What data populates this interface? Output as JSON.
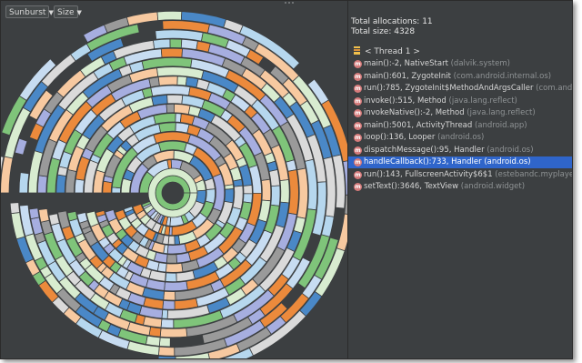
{
  "toolbar": {
    "chart_mode": "Sunburst",
    "sort_mode": "Size"
  },
  "summary": {
    "total_allocations": "Total allocations: 11",
    "total_size": "Total size: 4328"
  },
  "thread": {
    "label": "< Thread 1 >"
  },
  "stack_frames": [
    {
      "method": "main():-2, NativeStart",
      "package": "(dalvik.system)"
    },
    {
      "method": "main():601, ZygoteInit",
      "package": "(com.android.internal.os)"
    },
    {
      "method": "run():785, ZygoteInit$MethodAndArgsCaller",
      "package": "(com.android.internal.os)"
    },
    {
      "method": "invoke():515, Method",
      "package": "(java.lang.reflect)"
    },
    {
      "method": "invokeNative():-2, Method",
      "package": "(java.lang.reflect)"
    },
    {
      "method": "main():5001, ActivityThread",
      "package": "(android.app)"
    },
    {
      "method": "loop():136, Looper",
      "package": "(android.os)"
    },
    {
      "method": "dispatchMessage():95, Handler",
      "package": "(android.os)"
    },
    {
      "method": "handleCallback():733, Handler",
      "package": "(android.os)",
      "selected": true
    },
    {
      "method": "run():143, FullscreenActivity$6$1",
      "package": "(estebandc.myplayer)"
    },
    {
      "method": "setText():3646, TextView",
      "package": "(android.widget)"
    }
  ],
  "method_icon_glyph": "m",
  "palette": [
    "#7fc47a",
    "#c7dcf1",
    "#ec8a3c",
    "#a6aee0",
    "#9a9a9a",
    "#f7c9a0",
    "#d8ecd0",
    "#4a88c7",
    "#dadada",
    "#b6d7ee"
  ]
}
